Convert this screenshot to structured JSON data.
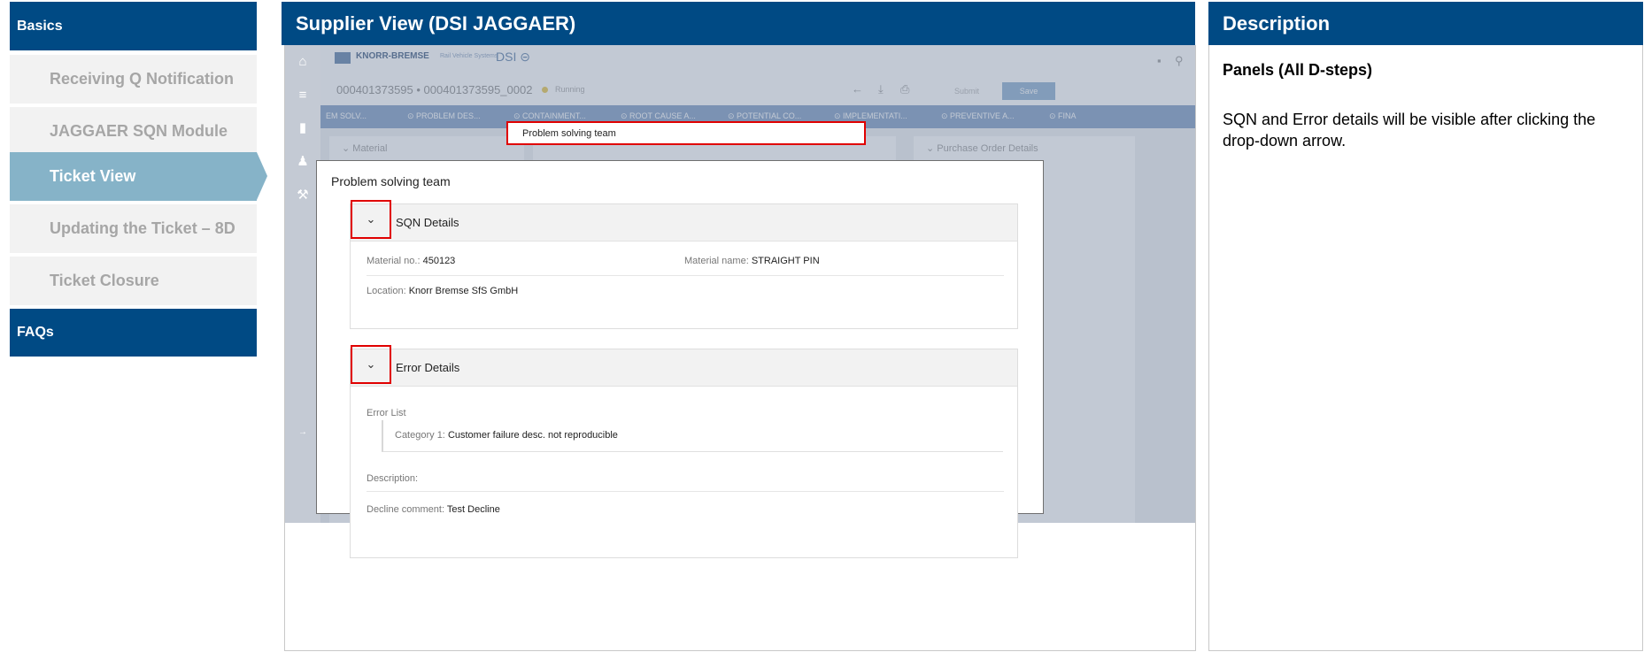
{
  "nav": {
    "basics": "Basics",
    "items": [
      {
        "label": "Receiving Q Notification"
      },
      {
        "label": "JAGGAER SQN Module"
      },
      {
        "label": "Ticket View"
      },
      {
        "label": "Updating the Ticket – 8D"
      },
      {
        "label": "Ticket Closure"
      }
    ],
    "faqs": "FAQs"
  },
  "supplier_view": {
    "title": "Supplier View (DSI JAGGAER)",
    "app": {
      "brand": "KNORR-BREMSE",
      "brand_sub": "Rail Vehicle Systems",
      "dsi": "DSI",
      "ticket_no": "000401373595 • 000401373595_0002",
      "status": "Running",
      "submit": "Submit",
      "save": "Save",
      "steps": [
        "EM SOLV...",
        "PROBLEM DES...",
        "CONTAINMENT...",
        "ROOT CAUSE A...",
        "POTENTIAL CO...",
        "IMPLEMENTATI...",
        "PREVENTIVE A...",
        "FINA"
      ],
      "material_label": "Material",
      "po_label": "Purchase Order Details",
      "problem_solving_team": "Problem solving team"
    },
    "popup": {
      "title": "Problem solving team",
      "sqn": {
        "title": "SQN Details",
        "material_no_label": "Material no.:",
        "material_no": "450123",
        "material_name_label": "Material name:",
        "material_name": "STRAIGHT PIN",
        "location_label": "Location:",
        "location": "Knorr Bremse SfS GmbH"
      },
      "error": {
        "title": "Error Details",
        "error_list_label": "Error List",
        "category_label": "Category 1:",
        "category": "Customer failure desc. not reproducible",
        "description_label": "Description:",
        "decline_label": "Decline comment:",
        "decline": "Test Decline"
      }
    }
  },
  "description": {
    "header": "Description",
    "title": "Panels (All D-steps)",
    "text": "SQN and Error details will be visible after clicking the drop-down arrow."
  }
}
